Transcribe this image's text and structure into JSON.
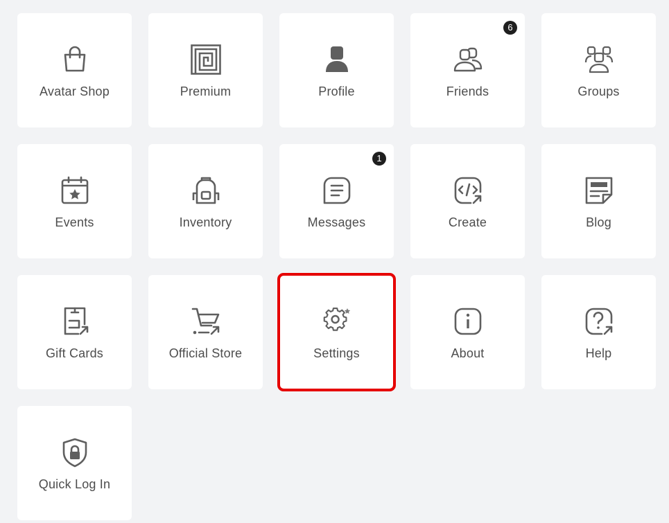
{
  "tiles": [
    {
      "id": "avatar-shop",
      "label": "Avatar Shop",
      "icon": "shopping-bag-icon"
    },
    {
      "id": "premium",
      "label": "Premium",
      "icon": "premium-icon"
    },
    {
      "id": "profile",
      "label": "Profile",
      "icon": "user-icon"
    },
    {
      "id": "friends",
      "label": "Friends",
      "icon": "friends-icon",
      "badge": "6"
    },
    {
      "id": "groups",
      "label": "Groups",
      "icon": "groups-icon"
    },
    {
      "id": "events",
      "label": "Events",
      "icon": "calendar-star-icon"
    },
    {
      "id": "inventory",
      "label": "Inventory",
      "icon": "backpack-icon"
    },
    {
      "id": "messages",
      "label": "Messages",
      "icon": "message-icon",
      "badge": "1"
    },
    {
      "id": "create",
      "label": "Create",
      "icon": "code-icon"
    },
    {
      "id": "blog",
      "label": "Blog",
      "icon": "blog-icon"
    },
    {
      "id": "gift-cards",
      "label": "Gift Cards",
      "icon": "gift-card-icon"
    },
    {
      "id": "official-store",
      "label": "Official Store",
      "icon": "shopping-cart-icon"
    },
    {
      "id": "settings",
      "label": "Settings",
      "icon": "gear-icon",
      "highlighted": true
    },
    {
      "id": "about",
      "label": "About",
      "icon": "info-icon"
    },
    {
      "id": "help",
      "label": "Help",
      "icon": "help-icon"
    },
    {
      "id": "quick-log-in",
      "label": "Quick Log In",
      "icon": "shield-lock-icon"
    }
  ],
  "colors": {
    "background": "#f2f3f5",
    "tile": "#ffffff",
    "text": "#4d4d4d",
    "icon": "#5f5f5f",
    "badge": "#1f1f1f",
    "highlight": "#e60000"
  }
}
